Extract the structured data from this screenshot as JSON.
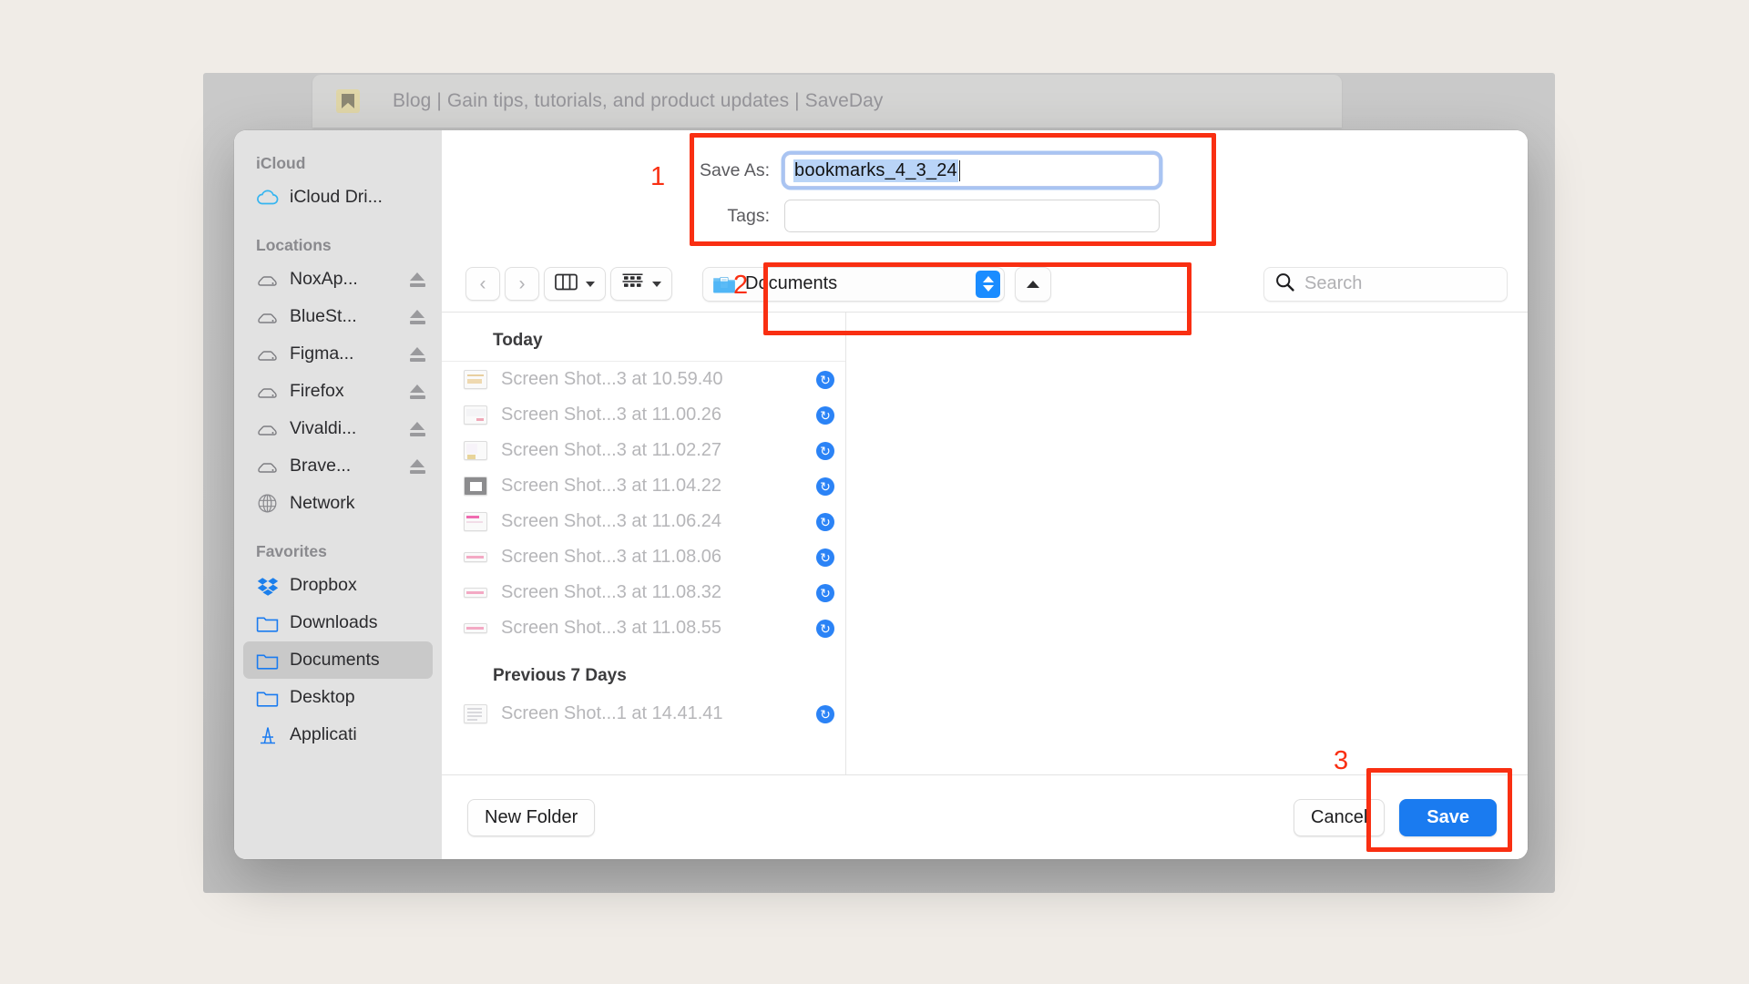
{
  "browser": {
    "tab_title": "Blog | Gain tips, tutorials, and product updates | SaveDay",
    "favicon": "bookmark-icon"
  },
  "dialog": {
    "save_as_label": "Save As:",
    "filename_value": "bookmarks_4_3_24",
    "tags_label": "Tags:",
    "tags_value": "",
    "tags_placeholder": ""
  },
  "toolbar": {
    "back_icon": "chevron-left-icon",
    "forward_icon": "chevron-right-icon",
    "view_columns_icon": "column-view-icon",
    "view_group_icon": "group-view-icon",
    "path_label": "Documents",
    "path_folder_icon": "documents-folder-icon",
    "stepper_icon": "chevron-up-down-icon",
    "collapse_icon": "chevron-up-icon",
    "search_placeholder": "Search",
    "search_icon": "search-icon",
    "search_value": ""
  },
  "sidebar": {
    "groups": [
      {
        "title": "iCloud",
        "items": [
          {
            "label": "iCloud Dri...",
            "icon": "icloud-icon",
            "eject": false,
            "selected": false
          }
        ]
      },
      {
        "title": "Locations",
        "items": [
          {
            "label": "NoxAp...",
            "icon": "disk-icon",
            "eject": true,
            "selected": false
          },
          {
            "label": "BlueSt...",
            "icon": "disk-icon",
            "eject": true,
            "selected": false
          },
          {
            "label": "Figma...",
            "icon": "disk-icon",
            "eject": true,
            "selected": false
          },
          {
            "label": "Firefox",
            "icon": "disk-icon",
            "eject": true,
            "selected": false
          },
          {
            "label": "Vivaldi...",
            "icon": "disk-icon",
            "eject": true,
            "selected": false
          },
          {
            "label": "Brave...",
            "icon": "disk-icon",
            "eject": true,
            "selected": false
          },
          {
            "label": "Network",
            "icon": "globe-icon",
            "eject": false,
            "selected": false
          }
        ]
      },
      {
        "title": "Favorites",
        "items": [
          {
            "label": "Dropbox",
            "icon": "dropbox-icon",
            "eject": false,
            "selected": false
          },
          {
            "label": "Downloads",
            "icon": "folder-icon",
            "eject": false,
            "selected": false
          },
          {
            "label": "Documents",
            "icon": "folder-icon",
            "eject": false,
            "selected": true
          },
          {
            "label": "Desktop",
            "icon": "folder-icon",
            "eject": false,
            "selected": false
          },
          {
            "label": "Applicati",
            "icon": "applications-icon",
            "eject": false,
            "selected": false
          }
        ]
      }
    ]
  },
  "file_list": {
    "groups": [
      {
        "header": "Today",
        "files": [
          {
            "name": "Screen Shot...3 at 10.59.40",
            "badge": "icloud-sync-icon"
          },
          {
            "name": "Screen Shot...3 at 11.00.26",
            "badge": "icloud-sync-icon"
          },
          {
            "name": "Screen Shot...3 at 11.02.27",
            "badge": "icloud-sync-icon"
          },
          {
            "name": "Screen Shot...3 at 11.04.22",
            "badge": "icloud-sync-icon"
          },
          {
            "name": "Screen Shot...3 at 11.06.24",
            "badge": "icloud-sync-icon"
          },
          {
            "name": "Screen Shot...3 at 11.08.06",
            "badge": "icloud-sync-icon"
          },
          {
            "name": "Screen Shot...3 at 11.08.32",
            "badge": "icloud-sync-icon"
          },
          {
            "name": "Screen Shot...3 at 11.08.55",
            "badge": "icloud-sync-icon"
          }
        ]
      },
      {
        "header": "Previous 7 Days",
        "files": [
          {
            "name": "Screen Shot...1 at 14.41.41",
            "badge": "icloud-sync-icon"
          }
        ]
      }
    ]
  },
  "footer": {
    "new_folder_label": "New Folder",
    "cancel_label": "Cancel",
    "save_label": "Save"
  },
  "annotations": {
    "one": "1",
    "two": "2",
    "three": "3",
    "color": "#f92f12"
  }
}
